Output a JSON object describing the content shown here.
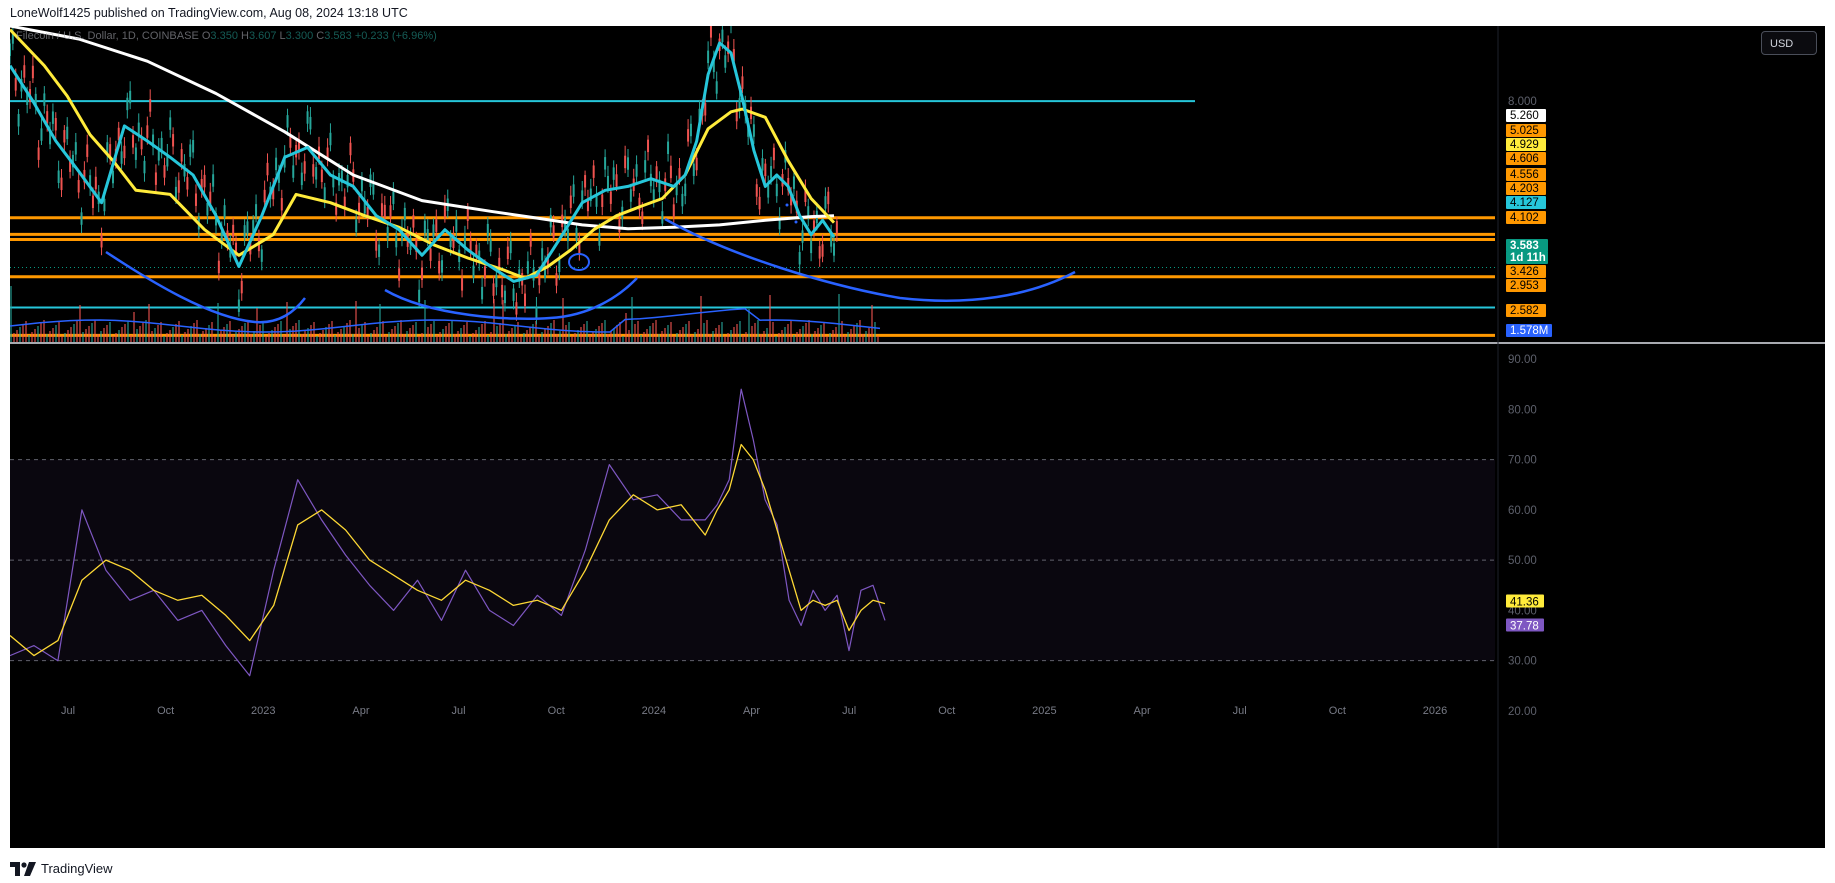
{
  "header": {
    "published_line": "LoneWolf1425 published on TradingView.com, Aug 08, 2024 13:18 UTC"
  },
  "footer": {
    "brand": "TradingView"
  },
  "legend": {
    "symbol": "Filecoin / U.S. Dollar, 1D, COINBASE",
    "open_label": "O",
    "open": "3.350",
    "high_label": "H",
    "high": "3.607",
    "low_label": "L",
    "low": "3.300",
    "close_label": "C",
    "close": "3.583",
    "change": "+0.233 (+6.96%)"
  },
  "currency_button": "USD",
  "colors": {
    "background": "#000000",
    "orange": "#ff9800",
    "cyan": "#26c6da",
    "blue_curve": "#2962ff",
    "yellow": "#ffeb3b",
    "white": "#ffffff",
    "up": "#26a69a",
    "down": "#ef5350",
    "rsi": "#7e57c2",
    "rsi_ma": "#fdd835",
    "current_price": "#089981",
    "volume_ma": "#2962ff"
  },
  "chart_data": [
    {
      "type": "line",
      "title": "",
      "y_scale": "log",
      "ylim": [
        2.5,
        11.5
      ],
      "x_axis_ticks": [
        "Jul",
        "Oct",
        "2023",
        "Apr",
        "Jul",
        "Oct",
        "2024",
        "Apr",
        "Jul",
        "Oct",
        "2025",
        "Apr",
        "Jul",
        "Oct",
        "2026"
      ],
      "y_axis_ticks": [
        "8.000"
      ],
      "x_index_range": [
        0,
        180
      ],
      "series": [
        {
          "kind": "ma-white",
          "x": [
            0,
            12,
            24,
            36,
            48,
            60,
            72,
            84,
            92,
            100,
            108,
            116,
            124,
            132,
            140,
            144
          ],
          "y": [
            11.5,
            10.8,
            9.7,
            8.3,
            6.9,
            5.6,
            4.95,
            4.7,
            4.55,
            4.4,
            4.32,
            4.35,
            4.4,
            4.5,
            4.58,
            4.6
          ]
        },
        {
          "kind": "ma-yellow",
          "x": [
            0,
            6,
            10,
            14,
            18,
            22,
            28,
            34,
            40,
            46,
            50,
            56,
            62,
            68,
            74,
            80,
            86,
            90,
            94,
            98,
            102,
            106,
            110,
            114,
            118,
            122,
            126,
            128,
            132,
            136,
            140,
            144
          ],
          "y": [
            11.3,
            9.5,
            8.2,
            6.8,
            6.0,
            5.2,
            5.1,
            4.3,
            3.8,
            4.2,
            5.1,
            4.9,
            4.6,
            4.35,
            4.0,
            3.75,
            3.55,
            3.4,
            3.6,
            3.9,
            4.3,
            4.6,
            4.8,
            5.0,
            5.6,
            7.0,
            7.6,
            7.7,
            7.4,
            6.0,
            5.0,
            4.45
          ]
        },
        {
          "kind": "ma-cyan",
          "x": [
            0,
            4,
            8,
            12,
            16,
            20,
            24,
            28,
            32,
            36,
            40,
            44,
            48,
            52,
            56,
            60,
            64,
            68,
            72,
            76,
            80,
            84,
            88,
            92,
            96,
            100,
            104,
            108,
            112,
            116,
            118,
            120,
            122,
            124,
            126,
            128,
            130,
            132,
            134,
            136,
            138,
            140,
            142,
            144
          ],
          "y": [
            9.5,
            8.0,
            6.6,
            5.7,
            4.9,
            7.1,
            6.6,
            6.1,
            5.6,
            4.6,
            3.6,
            4.6,
            6.1,
            6.4,
            5.6,
            5.3,
            4.6,
            4.3,
            3.8,
            4.3,
            3.9,
            3.6,
            3.35,
            3.45,
            4.1,
            4.9,
            5.2,
            5.3,
            5.5,
            5.3,
            5.6,
            6.6,
            9.1,
            10.6,
            10.1,
            8.1,
            6.3,
            5.3,
            5.6,
            5.3,
            4.6,
            4.2,
            4.5,
            4.15
          ]
        }
      ],
      "horizontal_levels": [
        {
          "color": "orange",
          "value": 4.556
        },
        {
          "color": "orange",
          "value": 4.203
        },
        {
          "color": "orange",
          "value": 4.102
        },
        {
          "color": "orange",
          "value": 3.426
        },
        {
          "color": "orange",
          "value": 2.582
        },
        {
          "color": "cyan",
          "value": 8.0
        },
        {
          "color": "cyan",
          "value": 2.953
        }
      ],
      "price_labels": [
        {
          "text": "5.260",
          "bg": "#ffffff",
          "fg": "#000000"
        },
        {
          "text": "5.025",
          "bg": "#ff9800",
          "fg": "#000000"
        },
        {
          "text": "4.929",
          "bg": "#ffeb3b",
          "fg": "#000000"
        },
        {
          "text": "4.606",
          "bg": "#ff9800",
          "fg": "#000000"
        },
        {
          "text": "4.556",
          "bg": "#ff9800",
          "fg": "#000000"
        },
        {
          "text": "4.203",
          "bg": "#ff9800",
          "fg": "#000000"
        },
        {
          "text": "4.127",
          "bg": "#26c6da",
          "fg": "#000000"
        },
        {
          "text": "4.102",
          "bg": "#ff9800",
          "fg": "#000000"
        },
        {
          "text": "3.583",
          "bg": "#089981",
          "fg": "#ffffff"
        },
        {
          "text": "1d 11h",
          "bg": "#089981",
          "fg": "#ffffff"
        },
        {
          "text": "3.426",
          "bg": "#ff9800",
          "fg": "#000000"
        },
        {
          "text": "2.953",
          "bg": "#ff9800",
          "fg": "#000000"
        },
        {
          "text": "2.582",
          "bg": "#ff9800",
          "fg": "#000000"
        },
        {
          "text": "1.578M",
          "bg": "#2962ff",
          "fg": "#ffffff"
        }
      ]
    },
    {
      "type": "line",
      "title": "",
      "ylim": [
        17,
        93
      ],
      "y_axis_ticks": [
        "90.00",
        "80.00",
        "70.00",
        "60.00",
        "50.00",
        "40.00",
        "30.00",
        "20.00"
      ],
      "bands": [
        70,
        50,
        30
      ],
      "series": [
        {
          "kind": "rsi",
          "x": [
            0,
            4,
            8,
            12,
            16,
            20,
            24,
            28,
            32,
            36,
            40,
            44,
            48,
            52,
            56,
            60,
            64,
            68,
            72,
            76,
            80,
            84,
            88,
            92,
            96,
            100,
            104,
            108,
            112,
            116,
            118,
            120,
            122,
            124,
            126,
            128,
            130,
            132,
            134,
            136,
            138,
            140,
            142,
            144,
            146
          ],
          "y": [
            31,
            33,
            30,
            60,
            48,
            42,
            44,
            38,
            40,
            33,
            27,
            48,
            66,
            58,
            51,
            45,
            40,
            46,
            38,
            48,
            40,
            37,
            43,
            39,
            52,
            69,
            62,
            63,
            58,
            58,
            61,
            66,
            84,
            74,
            62,
            57,
            42,
            37,
            44,
            40,
            43,
            32,
            44,
            45,
            38
          ]
        },
        {
          "kind": "rsi-ma",
          "x": [
            0,
            4,
            8,
            12,
            16,
            20,
            24,
            28,
            32,
            36,
            40,
            44,
            48,
            52,
            56,
            60,
            64,
            68,
            72,
            76,
            80,
            84,
            88,
            92,
            96,
            100,
            104,
            108,
            112,
            116,
            118,
            120,
            122,
            124,
            126,
            128,
            130,
            132,
            134,
            136,
            138,
            140,
            142,
            144,
            146
          ],
          "y": [
            35,
            31,
            34,
            46,
            50,
            48,
            44,
            42,
            43,
            39,
            34,
            41,
            57,
            60,
            56,
            50,
            47,
            44,
            42,
            46,
            44,
            41,
            42,
            40,
            48,
            58,
            63,
            60,
            61,
            55,
            60,
            64,
            73,
            70,
            64,
            56,
            48,
            40,
            42,
            41,
            42,
            36,
            40,
            42,
            41.36
          ]
        }
      ],
      "value_labels": [
        {
          "text": "41.36",
          "bg": "#ffeb3b",
          "fg": "#000000"
        },
        {
          "text": "37.78",
          "bg": "#7e57c2",
          "fg": "#ffffff"
        }
      ]
    }
  ]
}
